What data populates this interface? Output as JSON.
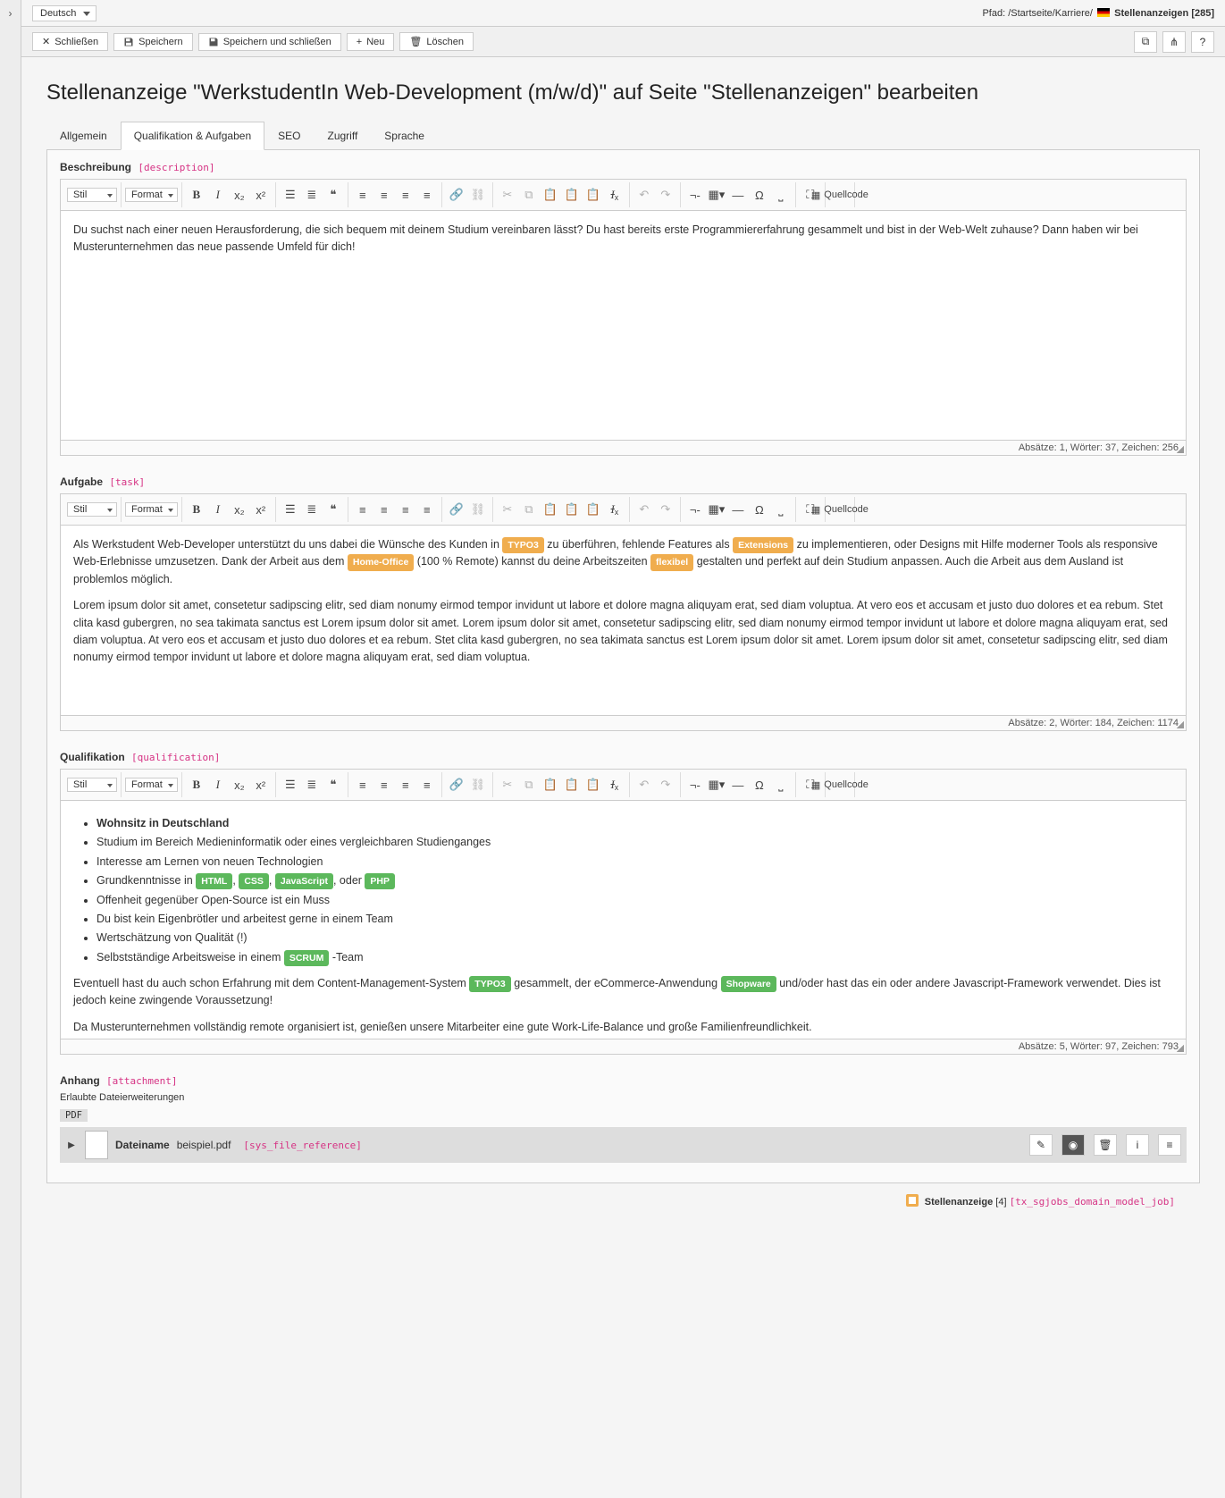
{
  "topbar": {
    "language": "Deutsch",
    "path_label": "Pfad:",
    "path_segments": "/Startseite/Karriere/",
    "path_current": "Stellenanzeigen",
    "path_id": "[285]"
  },
  "toolbar": {
    "close": "Schließen",
    "save": "Speichern",
    "save_close": "Speichern und schließen",
    "new": "Neu",
    "delete": "Löschen"
  },
  "page": {
    "title": "Stellenanzeige \"WerkstudentIn Web-Development (m/w/d)\" auf Seite \"Stellenanzeigen\" bearbeiten"
  },
  "tabs": {
    "general": "Allgemein",
    "qual": "Qualifikation & Aufgaben",
    "seo": "SEO",
    "access": "Zugriff",
    "lang": "Sprache"
  },
  "editor_labels": {
    "style": "Stil",
    "format": "Format",
    "source": "Quellcode"
  },
  "description": {
    "label": "Beschreibung",
    "key": "[description]",
    "text": "Du suchst nach einer neuen Herausforderung, die sich bequem mit deinem Studium vereinbaren lässt? Du hast bereits erste Programmiererfahrung gesammelt und bist in der Web-Welt zuhause? Dann haben wir bei Musterunternehmen das neue passende Umfeld für dich!",
    "status": "Absätze: 1, Wörter: 37, Zeichen: 256"
  },
  "task": {
    "label": "Aufgabe",
    "key": "[task]",
    "p1_a": "Als Werkstudent Web-Developer unterstützt du uns dabei die Wünsche des Kunden in ",
    "badge1": "TYPO3",
    "p1_b": " zu überführen, fehlende Features als ",
    "badge2": "Extensions",
    "p1_c": " zu implementieren, oder Designs mit Hilfe moderner Tools als responsive Web-Erlebnisse umzusetzen. Dank der Arbeit aus dem ",
    "badge3": "Home-Office",
    "p1_d": " (100 % Remote) kannst du deine Arbeitszeiten ",
    "badge4": "flexibel",
    "p1_e": " gestalten und perfekt auf dein Studium anpassen. Auch die Arbeit aus dem Ausland ist problemlos möglich.",
    "p2": "Lorem ipsum dolor sit amet, consetetur sadipscing elitr, sed diam nonumy eirmod tempor invidunt ut labore et dolore magna aliquyam erat, sed diam voluptua. At vero eos et accusam et justo duo dolores et ea rebum. Stet clita kasd gubergren, no sea takimata sanctus est Lorem ipsum dolor sit amet. Lorem ipsum dolor sit amet, consetetur sadipscing elitr, sed diam nonumy eirmod tempor invidunt ut labore et dolore magna aliquyam erat, sed diam voluptua. At vero eos et accusam et justo duo dolores et ea rebum. Stet clita kasd gubergren, no sea takimata sanctus est Lorem ipsum dolor sit amet. Lorem ipsum dolor sit amet, consetetur sadipscing elitr, sed diam nonumy eirmod tempor invidunt ut labore et dolore magna aliquyam erat, sed diam voluptua.",
    "status": "Absätze: 2, Wörter: 184, Zeichen: 1174"
  },
  "qualification": {
    "label": "Qualifikation",
    "key": "[qualification]",
    "li1": "Wohnsitz in Deutschland",
    "li2": "Studium im Bereich Medieninformatik oder eines vergleichbaren Studienganges",
    "li3": "Interesse am Lernen von neuen Technologien",
    "li4_a": "Grundkenntnisse in ",
    "li4_b1": "HTML",
    "li4_s1": ", ",
    "li4_b2": "CSS",
    "li4_s2": ", ",
    "li4_b3": "JavaScript",
    "li4_s3": ", oder ",
    "li4_b4": "PHP",
    "li5": "Offenheit gegenüber Open-Source ist ein Muss",
    "li6": "Du bist kein Eigenbrötler und arbeitest gerne in einem Team",
    "li7": "Wertschätzung von Qualität (!)",
    "li8_a": "Selbstständige Arbeitsweise in einem ",
    "li8_b": "SCRUM",
    "li8_c": " -Team",
    "p1_a": "Eventuell hast du auch schon Erfahrung mit dem Content-Management-System ",
    "p1_b1": "TYPO3",
    "p1_b": " gesammelt, der eCommerce-Anwendung ",
    "p1_b2": "Shopware",
    "p1_c": " und/oder hast das ein oder andere Javascript-Framework verwendet. Dies ist jedoch keine zwingende Voraussetzung!",
    "p2": "Da Musterunternehmen vollständig remote organisiert ist, genießen unsere Mitarbeiter eine gute Work-Life-Balance und große Familienfreundlichkeit.",
    "status": "Absätze: 5, Wörter: 97, Zeichen: 793"
  },
  "attachment": {
    "label": "Anhang",
    "key": "[attachment]",
    "allowed_label": "Erlaubte Dateierweiterungen",
    "ext": "PDF",
    "filename_label": "Dateiname",
    "filename": "beispiel.pdf",
    "file_key": "[sys_file_reference]"
  },
  "footer": {
    "record_label": "Stellenanzeige",
    "record_id": "[4]",
    "table_key": "[tx_sgjobs_domain_model_job]"
  }
}
